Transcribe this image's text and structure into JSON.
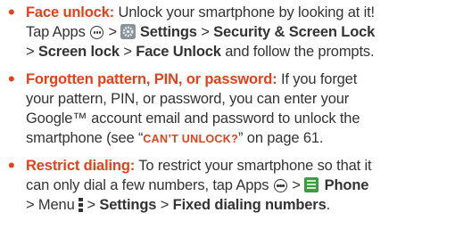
{
  "bullet_char": "•",
  "items": [
    {
      "term": "Face unlock:",
      "line1_rest": " Unlock your smartphone by looking at it!",
      "line2_tap": "Tap Apps ",
      "gt1": " > ",
      "settings": "Settings",
      "gt2": " > ",
      "security": "Security & Screen Lock",
      "line3_gt1": "> ",
      "screen_lock": "Screen lock",
      "line3_gt2": " > ",
      "face_unlock": "Face Unlock",
      "line3_rest": " and follow the prompts."
    },
    {
      "term": "Forgotten pattern, PIN, or password:",
      "line1_rest": " If you forget",
      "line2": "your pattern, PIN, or password, you can enter your",
      "line3": "Google™ account email and password to unlock the",
      "line4_pre": "smartphone (see “",
      "link": "CAN’T UNLOCK?",
      "line4_post": "” on page 61."
    },
    {
      "term": "Restrict dialing:",
      "line1_rest": " To restrict your smartphone so that it",
      "line2_pre": "can only dial a few numbers, tap Apps ",
      "gt1": " > ",
      "phone": "Phone",
      "line3_pre": "> Menu ",
      "gt2": " > ",
      "settings": "Settings",
      "gt3": " > ",
      "fixed": "Fixed dialing numbers",
      "period": "."
    }
  ],
  "colors": {
    "accent": "#e2411a",
    "text": "#333333",
    "phone_icon": "#3e9b3f"
  },
  "icons": [
    "apps-icon",
    "settings-gear-icon",
    "phone-app-icon",
    "menu-icon"
  ]
}
